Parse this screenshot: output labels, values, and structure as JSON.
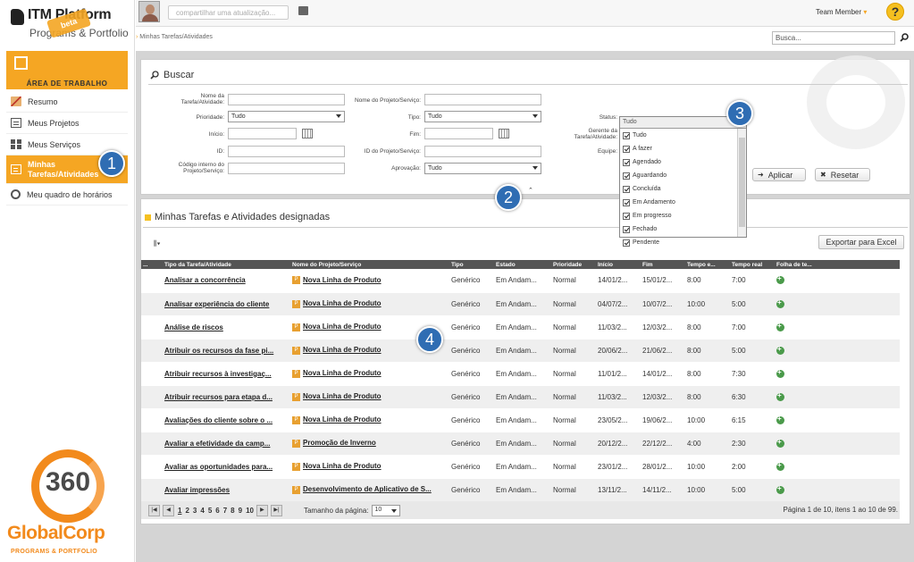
{
  "brand": {
    "logo_line1": "ITM Platform",
    "logo_line2": "Programs & Portfolio",
    "badge": "beta",
    "corp_number": "360",
    "corp_name": "GlobalCorp",
    "corp_tagline": "PROGRAMS & PORTFOLIO"
  },
  "sidebar": {
    "area_label": "ÁREA DE TRABALHO",
    "items": [
      {
        "label": "Resumo",
        "icon": "home-icon"
      },
      {
        "label": "Meus Projetos",
        "icon": "projects-icon"
      },
      {
        "label": "Meus Serviços",
        "icon": "services-icon"
      },
      {
        "label": "Minhas Tarefas/Atividades",
        "icon": "tasks-icon",
        "active": true
      },
      {
        "label": "Meu quadro de horários",
        "icon": "clock-icon"
      }
    ]
  },
  "header": {
    "share_placeholder": "compartilhar uma atualização...",
    "user": "Team Member",
    "help": "?",
    "breadcrumb": "Minhas Tarefas/Atividades",
    "search_placeholder": "Busca..."
  },
  "search": {
    "title": "Buscar",
    "labels": {
      "task_name": "Nome da Tarefa/Atividade:",
      "priority": "Prioridade:",
      "start": "Início:",
      "id": "ID:",
      "internal_code": "Código interno do Projeto/Serviço:",
      "project_name": "Nome do Projeto/Serviço:",
      "type": "Tipo:",
      "end": "Fim:",
      "project_id": "ID do Projeto/Serviço:",
      "approval": "Aprovação:",
      "status": "Status:",
      "manager": "Gerente da Tarefa/Atividade:",
      "team": "Equipe:"
    },
    "priority_value": "Tudo",
    "type_value": "Tudo",
    "approval_value": "Tudo",
    "status_value": "Tudo",
    "status_options": [
      "Tudo",
      "A fazer",
      "Agendado",
      "Aguardando",
      "Concluída",
      "Em Andamento",
      "Em progresso",
      "Fechado",
      "Pendente"
    ],
    "apply": "Aplicar",
    "reset": "Resetar"
  },
  "tasks": {
    "title": "Minhas Tarefas e Atividades designadas",
    "export": "Exportar para Excel",
    "columns": [
      "...",
      "Tipo da Tarefa/Atividade",
      "Nome do Projeto/Serviço",
      "Tipo",
      "Estado",
      "Prioridade",
      "Início",
      "Fim",
      "Tempo e...",
      "Tempo real",
      "Folha de te..."
    ],
    "rows": [
      {
        "task": "Analisar a concorrência",
        "project": "Nova Linha de Produto",
        "type": "Genérico",
        "state": "Em Andam...",
        "priority": "Normal",
        "start": "14/01/2...",
        "end": "15/01/2...",
        "est": "8:00",
        "real": "7:00"
      },
      {
        "task": "Analisar experiência do cliente",
        "project": "Nova Linha de Produto",
        "type": "Genérico",
        "state": "Em Andam...",
        "priority": "Normal",
        "start": "04/07/2...",
        "end": "10/07/2...",
        "est": "10:00",
        "real": "5:00"
      },
      {
        "task": "Análise de riscos",
        "project": "Nova Linha de Produto",
        "type": "Genérico",
        "state": "Em Andam...",
        "priority": "Normal",
        "start": "11/03/2...",
        "end": "12/03/2...",
        "est": "8:00",
        "real": "7:00"
      },
      {
        "task": "Atribuir os recursos da fase pi...",
        "project": "Nova Linha de Produto",
        "type": "Genérico",
        "state": "Em Andam...",
        "priority": "Normal",
        "start": "20/06/2...",
        "end": "21/06/2...",
        "est": "8:00",
        "real": "5:00"
      },
      {
        "task": "Atribuir recursos à investigaç...",
        "project": "Nova Linha de Produto",
        "type": "Genérico",
        "state": "Em Andam...",
        "priority": "Normal",
        "start": "11/01/2...",
        "end": "14/01/2...",
        "est": "8:00",
        "real": "7:30"
      },
      {
        "task": "Atribuir recursos para etapa d...",
        "project": "Nova Linha de Produto",
        "type": "Genérico",
        "state": "Em Andam...",
        "priority": "Normal",
        "start": "11/03/2...",
        "end": "12/03/2...",
        "est": "8:00",
        "real": "6:30"
      },
      {
        "task": "Avaliações do cliente sobre o ...",
        "project": "Nova Linha de Produto",
        "type": "Genérico",
        "state": "Em Andam...",
        "priority": "Normal",
        "start": "23/05/2...",
        "end": "19/06/2...",
        "est": "10:00",
        "real": "6:15"
      },
      {
        "task": "Avaliar a efetividade da camp...",
        "project": "Promoção de Inverno",
        "type": "Genérico",
        "state": "Em Andam...",
        "priority": "Normal",
        "start": "20/12/2...",
        "end": "22/12/2...",
        "est": "4:00",
        "real": "2:30"
      },
      {
        "task": "Avaliar as oportunidades para...",
        "project": "Nova Linha de Produto",
        "type": "Genérico",
        "state": "Em Andam...",
        "priority": "Normal",
        "start": "23/01/2...",
        "end": "28/01/2...",
        "est": "10:00",
        "real": "2:00"
      },
      {
        "task": "Avaliar impressões",
        "project": "Desenvolvimento de Aplicativo de S...",
        "type": "Genérico",
        "state": "Em Andam...",
        "priority": "Normal",
        "start": "13/11/2...",
        "end": "14/11/2...",
        "est": "10:00",
        "real": "5:00"
      }
    ],
    "pager": {
      "pages": [
        "1",
        "2",
        "3",
        "4",
        "5",
        "6",
        "7",
        "8",
        "9",
        "10"
      ],
      "page_size_label": "Tamanho da página:",
      "page_size": "10",
      "info": "Página 1 de 10, itens 1 ao 10 de 99."
    }
  },
  "callouts": [
    "1",
    "2",
    "3",
    "4"
  ]
}
